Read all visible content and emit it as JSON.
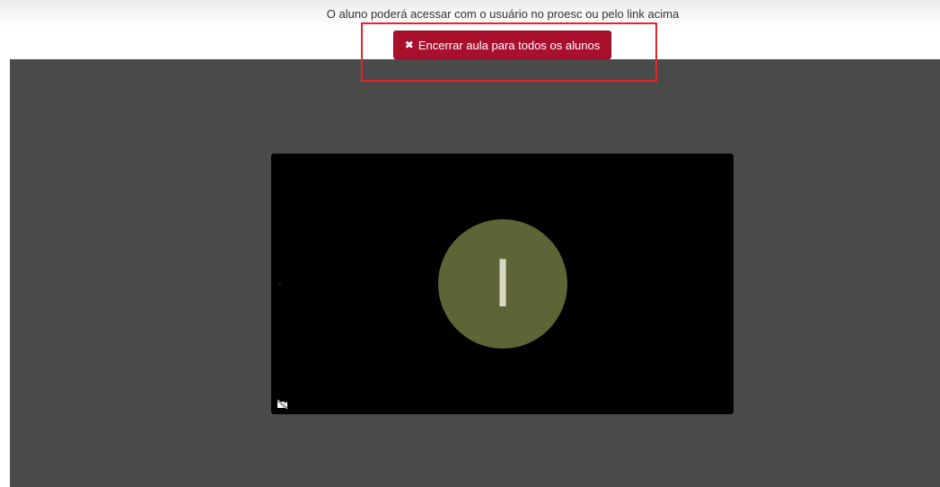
{
  "header": {
    "info_text": "O aluno poderá acessar com o usuário no proesc ou pelo link acima",
    "end_button_label": "Encerrar aula para todos os alunos",
    "end_button_icon": "close-icon"
  },
  "video": {
    "participant_initial": "I",
    "avatar_color": "#5e6435",
    "camera_icon": "camera-off-icon"
  },
  "colors": {
    "button": "#a8102e",
    "highlight": "#e8232b",
    "stage": "#4a4a4a"
  }
}
